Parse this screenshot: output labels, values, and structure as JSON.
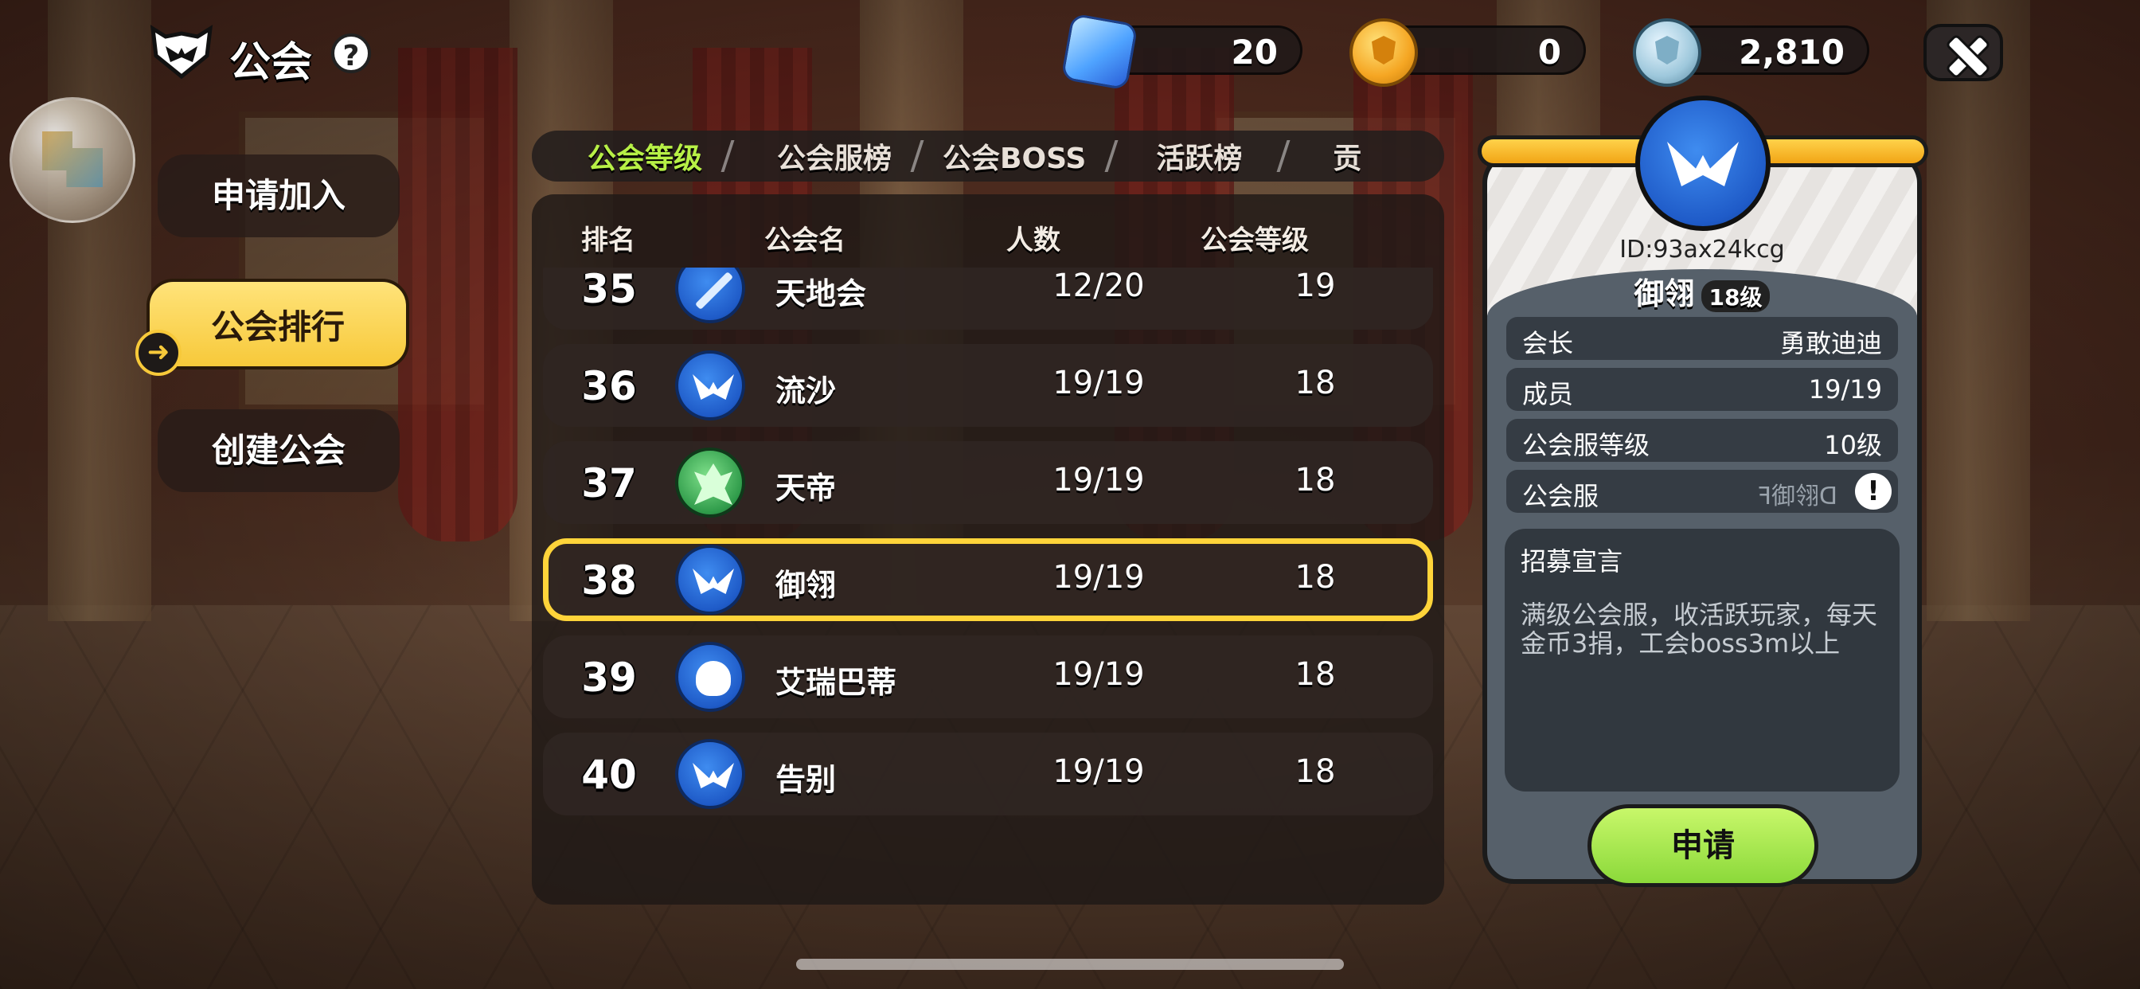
{
  "header": {
    "title": "公会",
    "help_label": "?"
  },
  "currencies": [
    {
      "name": "gem",
      "value": "20"
    },
    {
      "name": "gold-badge",
      "value": "0"
    },
    {
      "name": "silver-badge",
      "value": "2,810"
    }
  ],
  "side_menu": [
    {
      "label": "申请加入",
      "active": false
    },
    {
      "label": "公会排行",
      "active": true
    },
    {
      "label": "创建公会",
      "active": false
    }
  ],
  "tabs": [
    {
      "label": "公会等级",
      "active": true
    },
    {
      "label": "公会服榜",
      "active": false
    },
    {
      "label": "公会BOSS",
      "active": false
    },
    {
      "label": "活跃榜",
      "active": false
    },
    {
      "label": "贡",
      "active": false
    }
  ],
  "columns": {
    "rank": "排名",
    "name": "公会名",
    "members": "人数",
    "level": "公会等级"
  },
  "rows": [
    {
      "rank": "35",
      "name": "天地会",
      "members": "12/20",
      "level": "19",
      "emblem": "sword"
    },
    {
      "rank": "36",
      "name": "流沙",
      "members": "19/19",
      "level": "18",
      "emblem": "wings"
    },
    {
      "rank": "37",
      "name": "天帝",
      "members": "19/19",
      "level": "18",
      "emblem": "leaf"
    },
    {
      "rank": "38",
      "name": "御翎",
      "members": "19/19",
      "level": "18",
      "emblem": "wings",
      "selected": true
    },
    {
      "rank": "39",
      "name": "艾瑞巴蒂",
      "members": "19/19",
      "level": "18",
      "emblem": "skull"
    },
    {
      "rank": "40",
      "name": "告别",
      "members": "19/19",
      "level": "18",
      "emblem": "wings"
    }
  ],
  "detail": {
    "id": "ID:93ax24kcg",
    "name": "御翎",
    "level_badge": "18级",
    "fields": [
      {
        "key": "会长",
        "value": "勇敢迪迪"
      },
      {
        "key": "成员",
        "value": "19/19"
      },
      {
        "key": "公会服等级",
        "value": "10级"
      },
      {
        "key": "公会服",
        "value": "ꟻ御翎ᗡ"
      }
    ],
    "declaration_title": "招募宣言",
    "declaration_text": "满级公会服，收活跃玩家，每天金币3捐，工会boss3m以上",
    "apply_label": "申请"
  },
  "colors": {
    "accent_green": "#b7f046",
    "highlight_yellow": "#ffd43a",
    "apply_green": "#8bd93a"
  }
}
